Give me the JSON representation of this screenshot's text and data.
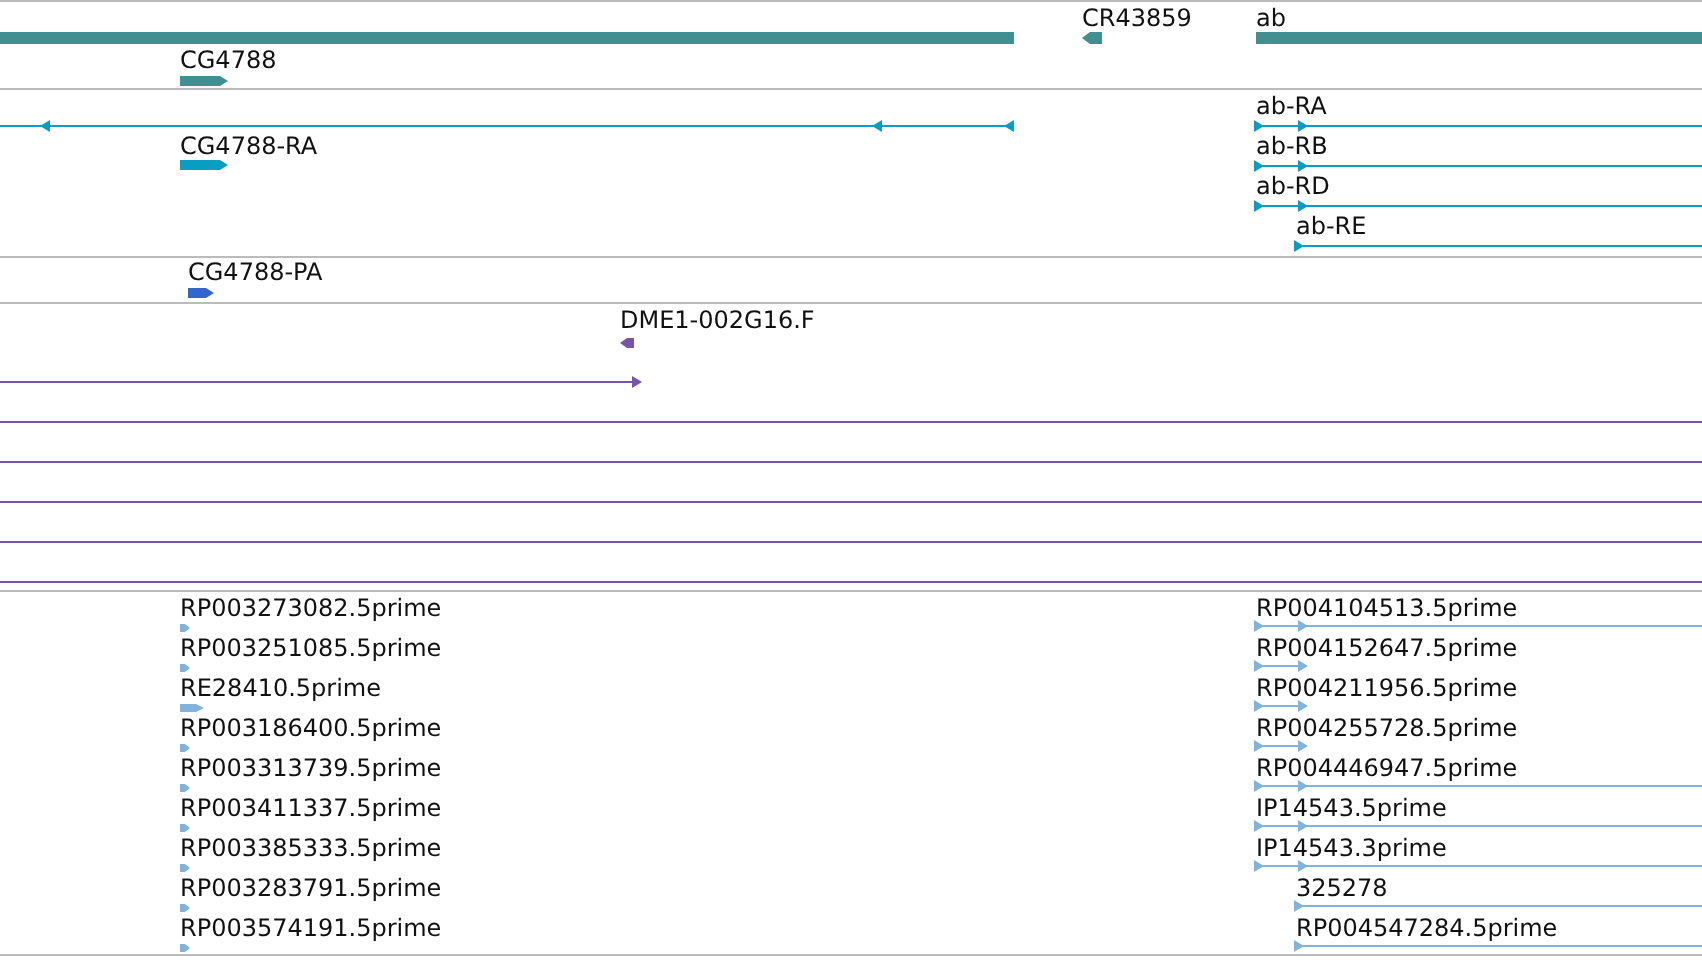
{
  "tracks": [
    {
      "features": [
        {
          "label": "CR43859",
          "reverse": true
        },
        {
          "label": "ab",
          "reverse": false
        },
        {
          "label": "CG4788",
          "reverse": false
        }
      ]
    },
    {
      "features": [
        {
          "label": "CG4788-RA",
          "reverse": false
        },
        {
          "label": "ab-RA",
          "reverse": false
        },
        {
          "label": "ab-RB",
          "reverse": false
        },
        {
          "label": "ab-RD",
          "reverse": false
        },
        {
          "label": "ab-RE",
          "reverse": false
        }
      ]
    },
    {
      "features": [
        {
          "label": "CG4788-PA",
          "reverse": false
        }
      ]
    },
    {
      "features": [
        {
          "label": "DME1-002G16.F",
          "reverse": true
        }
      ]
    },
    {
      "features": [
        {
          "label": "RP003273082.5prime",
          "reverse": false
        },
        {
          "label": "RP003251085.5prime",
          "reverse": false
        },
        {
          "label": "RE28410.5prime",
          "reverse": false
        },
        {
          "label": "RP003186400.5prime",
          "reverse": false
        },
        {
          "label": "RP003313739.5prime",
          "reverse": false
        },
        {
          "label": "RP003411337.5prime",
          "reverse": false
        },
        {
          "label": "RP003385333.5prime",
          "reverse": false
        },
        {
          "label": "RP003283791.5prime",
          "reverse": false
        },
        {
          "label": "RP003574191.5prime",
          "reverse": false
        },
        {
          "label": "RP004104513.5prime",
          "reverse": false
        },
        {
          "label": "RP004152647.5prime",
          "reverse": false
        },
        {
          "label": "RP004211956.5prime",
          "reverse": false
        },
        {
          "label": "RP004255728.5prime",
          "reverse": false
        },
        {
          "label": "RP004446947.5prime",
          "reverse": false
        },
        {
          "label": "IP14543.5prime",
          "reverse": false
        },
        {
          "label": "IP14543.3prime",
          "reverse": false
        },
        {
          "label": "325278",
          "reverse": false
        },
        {
          "label": "RP004547284.5prime",
          "reverse": false
        }
      ]
    }
  ]
}
